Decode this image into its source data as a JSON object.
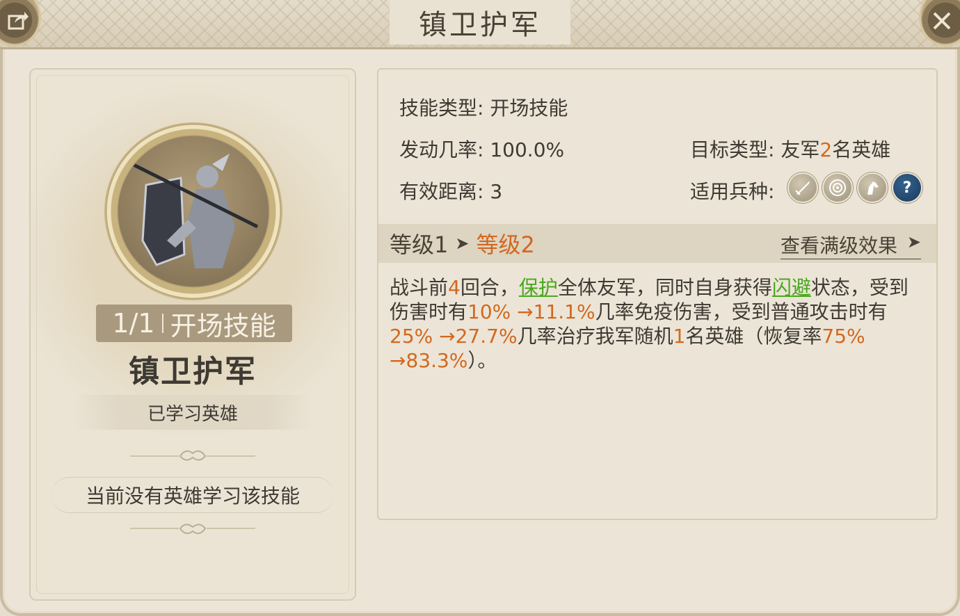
{
  "header": {
    "title": "镇卫护军"
  },
  "left": {
    "progress": "1/1",
    "skill_type_badge": "开场技能",
    "skill_name": "镇卫护军",
    "learned_label": "已学习英雄",
    "no_hero_text": "当前没有英雄学习该技能"
  },
  "info": {
    "skill_type_label": "技能类型:",
    "skill_type_value": "开场技能",
    "trigger_label": "发动几率:",
    "trigger_value": "100.0%",
    "range_label": "有效距离:",
    "range_value": "3",
    "target_label": "目标类型:",
    "target_prefix": "友军",
    "target_count": "2",
    "target_suffix": "名英雄",
    "troop_label": "适用兵种:",
    "troop_icons": [
      "sword-icon",
      "target-icon",
      "horse-icon",
      "question-icon"
    ],
    "unknown_icon_text": "?"
  },
  "level": {
    "current": "等级1",
    "next": "等级2",
    "view_max": "查看满级效果"
  },
  "description": {
    "p1": "战斗前",
    "n1": "4",
    "p2": "回合，",
    "k1": "保护",
    "p3": "全体友军，同时自身获得",
    "k2": "闪避",
    "p4": "状态，受到伤害时有",
    "n2": "10%",
    "n3": "→11.1%",
    "p5": "几率免疫伤害，受到普通攻击时有",
    "n4": "25%",
    "n5": "→27.7%",
    "p6": "几率治疗我军随机",
    "n6": "1",
    "p7": "名英雄（恢复率",
    "n7": "75%",
    "n8": "→83.3%",
    "p8": "）。"
  },
  "colors": {
    "accent": "#d2681e",
    "keyword": "#47a81c",
    "text": "#3e3a33",
    "background": "#ece5d7"
  }
}
